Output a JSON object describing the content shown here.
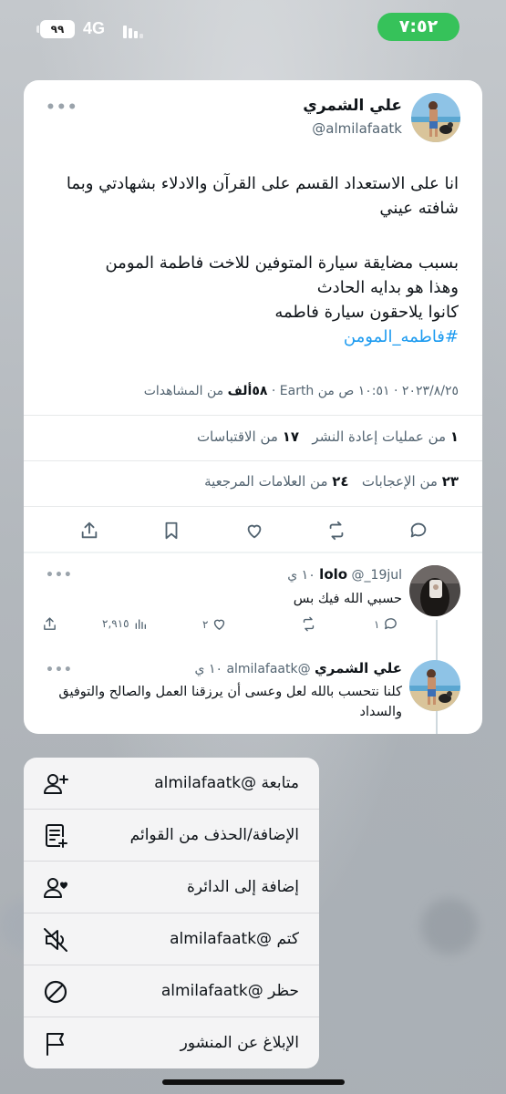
{
  "status_bar": {
    "time": "٧:٥٢",
    "network": "4G",
    "battery": "٩٩",
    "colors": {
      "time_pill": "#36c25a"
    }
  },
  "tweet": {
    "author_name": "علي الشمري",
    "author_handle": "@almilafaatk",
    "body_line1": "انا على الاستعداد القسم على القرآن والادلاء بشهادتي وبما شافته عيني",
    "body_line2": "بسبب مضايقة سيارة المتوفين للاخت فاطمة المومن",
    "body_line3": "وهذا هو بدايه الحادث",
    "body_line4": "كانوا يلاحقون سيارة فاطمه",
    "hashtag": "#فاطمه_المومن",
    "meta": {
      "time": "١٠:٥١ ص",
      "date": "٢٠٢٣/٨/٢٥",
      "source": "من Earth",
      "views_count": "٥٨ألف",
      "views_label": "من المشاهدات",
      "separator": "·"
    },
    "stats": {
      "retweets_count": "١",
      "retweets_label": "من عمليات إعادة النشر",
      "quotes_count": "١٧",
      "quotes_label": "من الاقتباسات",
      "likes_count": "٢٣",
      "likes_label": "من الإعجابات",
      "bookmarks_count": "٢٤",
      "bookmarks_label": "من العلامات المرجعية"
    }
  },
  "replies": [
    {
      "name": "lolo",
      "handle": "@_19jul",
      "time": "١٠ ي",
      "text": "حسبي الله فيك بس",
      "reply_count": "١",
      "like_count": "٢",
      "views_count": "٢,٩١٥"
    },
    {
      "name": "علي الشمري",
      "handle": "@almilafaatk",
      "time": "١٠ ي",
      "text": "كلنا نتحسب بالله لعل وعسى أن يرزقنا العمل والصالح والتوفيق والسداد"
    }
  ],
  "menu": {
    "items": [
      {
        "label": "متابعة @almilafaatk",
        "icon": "follow-user-icon"
      },
      {
        "label": "الإضافة/الحذف من القوائم",
        "icon": "list-add-icon"
      },
      {
        "label": "إضافة إلى الدائرة",
        "icon": "circle-add-icon"
      },
      {
        "label": "كتم @almilafaatk",
        "icon": "mute-icon"
      },
      {
        "label": "حظر @almilafaatk",
        "icon": "block-icon"
      },
      {
        "label": "الإبلاغ عن المنشور",
        "icon": "flag-icon"
      }
    ]
  },
  "colors": {
    "link": "#1d9bf0",
    "text": "#0f1419",
    "secondary": "#536471"
  }
}
